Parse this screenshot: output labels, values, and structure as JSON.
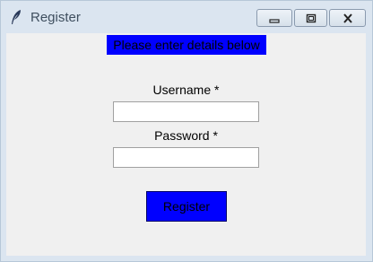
{
  "window": {
    "title": "Register",
    "app_icon": "feather-icon",
    "controls": {
      "minimize_icon": "minimize-icon",
      "maximize_icon": "maximize-icon",
      "close_icon": "close-icon"
    }
  },
  "form": {
    "banner_text": "Please enter details below",
    "banner_color": "#0000ff",
    "username_label": "Username *",
    "username_value": "",
    "password_label": "Password *",
    "password_value": "",
    "register_label": "Register",
    "register_color": "#0000ff"
  }
}
